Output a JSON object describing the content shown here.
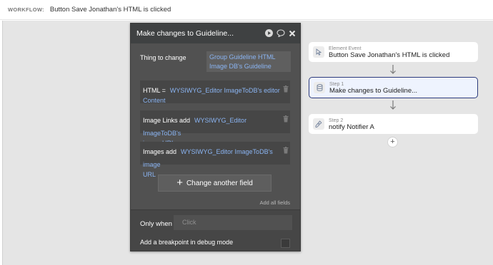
{
  "header": {
    "label": "WORKFLOW:",
    "workflow_name": "Button Save Jonathan's HTML is clicked"
  },
  "panel": {
    "title": "Make changes to Guideline...",
    "thing_label": "Thing to change",
    "thing_value_line1": "Group Guideline HTML",
    "thing_value_line2": "Image DB's Guideline",
    "fields": [
      {
        "label": "HTML =",
        "expr_line1": "WYSIWYG_Editor ImageToDB's editor",
        "expr_line2": "Content"
      },
      {
        "label": "Image Links add",
        "expr_line1": "WYSIWYG_Editor ImageToDB's",
        "expr_line2": "image URL"
      },
      {
        "label": "Images add",
        "expr_line1": "WYSIWYG_Editor ImageToDB's image",
        "expr_line2": "URL"
      }
    ],
    "change_button": "Change another field",
    "add_all_link": "Add all fields",
    "only_when_label": "Only when",
    "only_when_placeholder": "Click",
    "breakpoint_label": "Add a breakpoint in debug mode"
  },
  "steps": [
    {
      "sub": "Element Event",
      "title": "Button Save Jonathan's HTML is clicked",
      "icon": "cursor-click-icon"
    },
    {
      "sub": "Step 1",
      "title": "Make changes to Guideline...",
      "icon": "database-icon"
    },
    {
      "sub": "Step 2",
      "title": "notify Notifier A",
      "icon": "plugin-icon"
    }
  ],
  "add_step_symbol": "+",
  "colors": {
    "panel_bg": "#515151",
    "panel_header": "#3f4142",
    "expression_text": "#8ab4f2",
    "selected_border": "#2c3a7c",
    "selected_bg": "#eef3fe",
    "canvas_bg": "#e5e5e5"
  }
}
